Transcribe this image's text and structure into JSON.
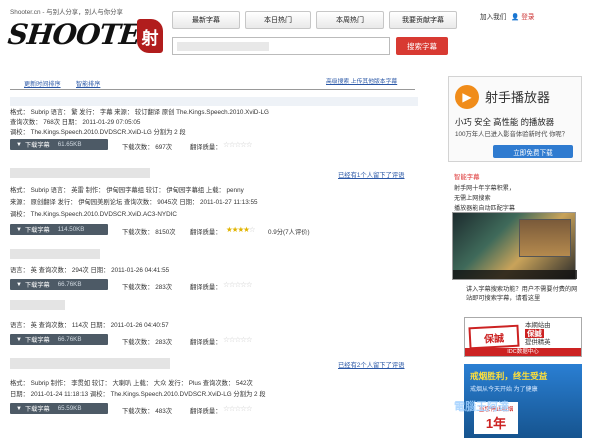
{
  "header": {
    "tagline": "Shooter.cn - 与别人分享，别人与你分享",
    "logo_text": "SHOOTER",
    "seal_char": "射",
    "nav": [
      "最新字幕",
      "本日热门",
      "本周热门",
      "我要贡献字幕"
    ],
    "login": "加入我们",
    "register": "登录",
    "search_button": "搜索字幕"
  },
  "tabs": {
    "sort_updated": "更新时间排序",
    "sort_smart": "智能排序",
    "right_links": "高级搜索 上传其他版本字幕"
  },
  "results": [
    {
      "line1": "格式： Subrip    语言： 繁    发行： 字幕    来源： 较订翻译 原创 The.Kings.Speech.2010.XviD-LG",
      "line2": "查询次数： 768次    日期： 2011-01-29 07:05:05",
      "line3": "调校： The.Kings.Speech.2010.DVDSCR.XviD-LG 分割为 2 段",
      "download": "下载字幕",
      "size": "61.65KB",
      "downloads": "下载次数： 697次",
      "rating_label": "翻译质量：",
      "stars": 0,
      "comment": ""
    },
    {
      "line1": "格式： Subrip    语言： 英雷            制作： 伊甸园字幕组      较订： 伊甸园字幕组      上载： penny",
      "line2": "来源： 原创翻译      发行： 伊甸园美剧论坛          查询次数： 9045次         日期： 2011-01-27 11:13:55",
      "line3": "调校： The.Kings.Speech.2010.DVDSCR.XviD.AC3-NYDIC",
      "download": "下载字幕",
      "size": "114.50KB",
      "downloads": "下载次数： 8150次",
      "rating_label": "翻译质量：",
      "stars": 4,
      "rating_text": "0.9分(7人评价)",
      "comment": "已经有1个人留下了评语"
    },
    {
      "line1": "语言： 英    查询次数： 294次          日期： 2011-01-26 04:41:55",
      "download": "下载字幕",
      "size": "66.76KB",
      "downloads": "下载次数： 283次",
      "rating_label": "翻译质量：",
      "stars": 0,
      "comment": ""
    },
    {
      "line1": "语言： 英    查询次数： 114次          日期： 2011-01-26 04:40:57",
      "download": "下载字幕",
      "size": "66.76KB",
      "downloads": "下载次数： 283次",
      "rating_label": "翻译质量：",
      "stars": 0,
      "comment": "已经有2个人留下了评语"
    },
    {
      "line1": "格式： Subrip    制作： 李贯如       较订： 大喇叭     上载： 大众      发行： Plus       查询次数： 542次",
      "line2": "日期： 2011-01-24 11:18:13    调校： The.Kings.Speech.2010.DVDSCR.XviD-LG 分割为 2 段",
      "download": "下载字幕",
      "size": "65.59KB",
      "downloads": "下载次数： 483次",
      "rating_label": "翻译质量：",
      "stars": 0,
      "comment": ""
    }
  ],
  "sidebar": {
    "player_title": "射手播放器",
    "player_slogan": "小巧 安全 高性能 的播放器",
    "player_desc": "100万年人已进入影音体验新时代 你呢？",
    "player_button": "立即免费下载",
    "features_title": "智能字幕",
    "features": [
      "射手网十年字幕积累，",
      "无需上网搜索",
      "播放器能自动匹配字幕"
    ],
    "note": "讲入字幕搜索功能？用户不需要付费的网站即可搜索字幕，请看这里",
    "ad1_stamp": "保誠",
    "ad1_line1": "本網站由",
    "ad1_badge": "保誠",
    "ad1_line2": "提供精英",
    "ad1_bottom": "IDC数据中心",
    "ad2_head": "戒烟胜利，终生受益",
    "ad2_sub": "戒烟从今天开始 为了健康",
    "ad2_box1": "当您停止吸烟",
    "ad2_box2": "1年",
    "watermark": "電腦王阿達"
  },
  "colors": {
    "accent_red": "#d83a32",
    "download_btn": "#4d5a66",
    "link_blue": "#2a57a6",
    "player_orange": "#f08c1a"
  }
}
